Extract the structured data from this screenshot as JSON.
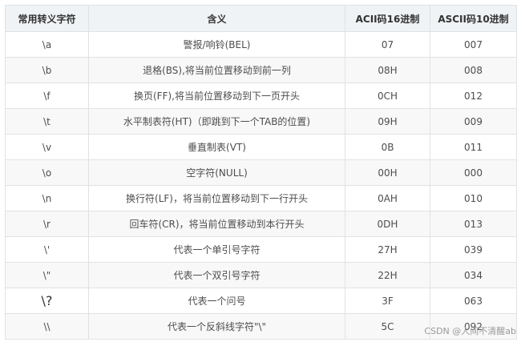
{
  "table": {
    "headers": [
      "常用转义字符",
      "含义",
      "ACII码16进制",
      "ASCII码10进制"
    ],
    "rows": [
      [
        "\\a",
        "警报/响铃(BEL)",
        "07",
        "007"
      ],
      [
        "\\b",
        "退格(BS),将当前位置移动到前一列",
        "08H",
        "008"
      ],
      [
        "\\f",
        "换页(FF),将当前位置移动到下一页开头",
        "0CH",
        "012"
      ],
      [
        "\\t",
        "水平制表符(HT)（即跳到下一个TAB的位置)",
        "09H",
        "009"
      ],
      [
        "\\v",
        "垂直制表(VT)",
        "0B",
        "011"
      ],
      [
        "\\o",
        "空字符(NULL)",
        "00H",
        "000"
      ],
      [
        "\\n",
        "换行符(LF)，将当前位置移动到下一行开头",
        "0AH",
        "010"
      ],
      [
        "\\r",
        "回车符(CR)，将当前位置移动到本行开头",
        "0DH",
        "013"
      ],
      [
        "\\'",
        "代表一个单引号字符",
        "27H",
        "039"
      ],
      [
        "\\\"",
        "代表一个双引号字符",
        "22H",
        "034"
      ],
      [
        "\\?",
        "代表一个问号",
        "3F",
        "063"
      ],
      [
        "\\\\",
        "代表一个反斜线字符\"\\\"",
        "5C",
        "092"
      ]
    ]
  },
  "watermark": "CSDN @人间不清醒ab"
}
